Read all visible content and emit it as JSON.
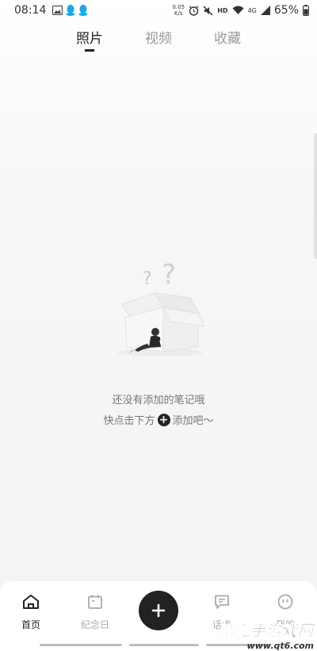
{
  "status_bar": {
    "time": "08:14",
    "net_speed_value": "0.05",
    "net_speed_unit": "K/s",
    "hd": "HD",
    "network": "4G",
    "battery": "65%",
    "left_icons": [
      "image-icon",
      "qq-icon",
      "qq-icon"
    ],
    "right_icons": [
      "alarm-icon",
      "mute-icon",
      "wifi-icon",
      "signal-icon",
      "battery-icon"
    ]
  },
  "tabs": [
    {
      "label": "照片",
      "active": true
    },
    {
      "label": "视频",
      "active": false
    },
    {
      "label": "收藏",
      "active": false
    }
  ],
  "empty_state": {
    "line1": "还没有添加的笔记哦",
    "line2_before": "快点击下方",
    "plus_symbol": "+",
    "line2_after": "添加吧～"
  },
  "bottom_nav": {
    "items": [
      {
        "label": "首页",
        "icon": "home-icon",
        "active": true
      },
      {
        "label": "纪念日",
        "icon": "calendar-icon",
        "active": false
      },
      {
        "label": "话术",
        "icon": "message-icon",
        "active": false
      },
      {
        "label": "我的",
        "icon": "profile-icon",
        "active": false
      }
    ],
    "fab_icon": "plus-icon"
  },
  "watermark": {
    "title": "蜻蜓手游戏网",
    "url": "www.qt6.com"
  },
  "colors": {
    "active": "#222222",
    "inactive": "#aaaaaa",
    "background": "#f5f5f5"
  }
}
